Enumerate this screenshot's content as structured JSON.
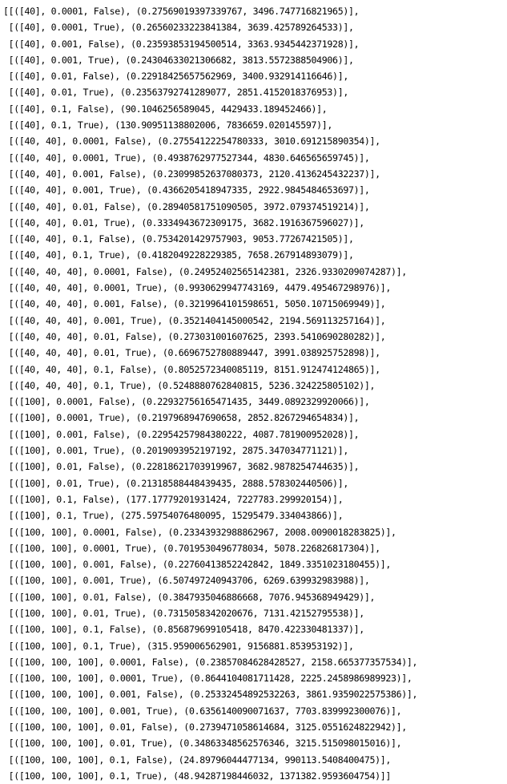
{
  "output": {
    "lines": [
      "[[([40], 0.0001, False), (0.27569019397339767, 3496.747716821965)],",
      " [([40], 0.0001, True), (0.26560233223841384, 3639.425789264533)],",
      " [([40], 0.001, False), (0.23593853194500514, 3363.9345442371928)],",
      " [([40], 0.001, True), (0.24304633021306682, 3813.5572388504906)],",
      " [([40], 0.01, False), (0.22918425657562969, 3400.932914116646)],",
      " [([40], 0.01, True), (0.23563792741289077, 2851.4152018376953)],",
      " [([40], 0.1, False), (90.1046256589045, 4429433.189452466)],",
      " [([40], 0.1, True), (130.90951138802006, 7836659.020145597)],",
      " [([40, 40], 0.0001, False), (0.27554122254780333, 3010.691215890354)],",
      " [([40, 40], 0.0001, True), (0.4938762977527344, 4830.646565659745)],",
      " [([40, 40], 0.001, False), (0.23099852637080373, 2120.4136245432237)],",
      " [([40, 40], 0.001, True), (0.4366205418947335, 2922.9845484653697)],",
      " [([40, 40], 0.01, False), (0.28940581751090505, 3972.079374519214)],",
      " [([40, 40], 0.01, True), (0.3334943672309175, 3682.1916367596027)],",
      " [([40, 40], 0.1, False), (0.7534201429757903, 9053.77267421505)],",
      " [([40, 40], 0.1, True), (0.4182049228229385, 7658.267914893079)],",
      " [([40, 40, 40], 0.0001, False), (0.24952402565142381, 2326.9330209074287)],",
      " [([40, 40, 40], 0.0001, True), (0.9930629947743169, 4479.495467298976)],",
      " [([40, 40, 40], 0.001, False), (0.3219964101598651, 5050.10715069949)],",
      " [([40, 40, 40], 0.001, True), (0.3521404145000542, 2194.569113257164)],",
      " [([40, 40, 40], 0.01, False), (0.273031001607625, 2393.5410690280282)],",
      " [([40, 40, 40], 0.01, True), (0.6696752780889447, 3991.038925752898)],",
      " [([40, 40, 40], 0.1, False), (0.8052572340085119, 8151.912474124865)],",
      " [([40, 40, 40], 0.1, True), (0.5248880762840815, 5236.324225805102)],",
      " [([100], 0.0001, False), (0.22932756165471435, 3449.0892329920066)],",
      " [([100], 0.0001, True), (0.2197968947690658, 2852.8267294654834)],",
      " [([100], 0.001, False), (0.22954257984380222, 4087.781900952028)],",
      " [([100], 0.001, True), (0.2019093952197192, 2875.347034771121)],",
      " [([100], 0.01, False), (0.22818621703919967, 3682.9878254744635)],",
      " [([100], 0.01, True), (0.21318588448439435, 2888.578302440506)],",
      " [([100], 0.1, False), (177.17779201931424, 7227783.299920154)],",
      " [([100], 0.1, True), (275.59754076480095, 15295479.334043866)],",
      " [([100, 100], 0.0001, False), (0.23343932988862967, 2008.0090018283825)],",
      " [([100, 100], 0.0001, True), (0.7019530496778034, 5078.226826817304)],",
      " [([100, 100], 0.001, False), (0.22760413852242842, 1849.3351023180455)],",
      " [([100, 100], 0.001, True), (6.507497240943706, 6269.639932983988)],",
      " [([100, 100], 0.01, False), (0.3847935046886668, 7076.945368949429)],",
      " [([100, 100], 0.01, True), (0.7315058342020676, 7131.42152795538)],",
      " [([100, 100], 0.1, False), (0.856879699105418, 8470.422330481337)],",
      " [([100, 100], 0.1, True), (315.959006562901, 9156881.853953192)],",
      " [([100, 100, 100], 0.0001, False), (0.23857084628428527, 2158.665377357534)],",
      " [([100, 100, 100], 0.0001, True), (0.8644104081711428, 2225.2458986989923)],",
      " [([100, 100, 100], 0.001, False), (0.25332454892532263, 3861.9359022575386)],",
      " [([100, 100, 100], 0.001, True), (0.6356140090071637, 7703.839992300076)],",
      " [([100, 100, 100], 0.01, False), (0.2739471058614684, 3125.0551624822942)],",
      " [([100, 100, 100], 0.01, True), (0.34863348562576346, 3215.515098015016)],",
      " [([100, 100, 100], 0.1, False), (24.89796044477134, 990113.5408400475)],",
      " [([100, 100, 100], 0.1, True), (48.94287198446032, 1371382.9593604754)]]"
    ]
  }
}
